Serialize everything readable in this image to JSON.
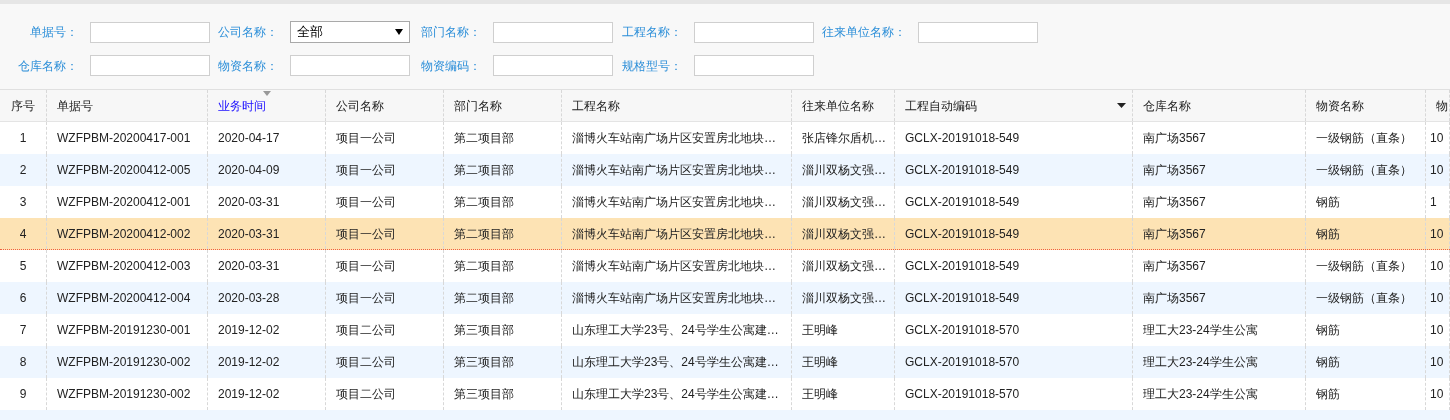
{
  "filters": [
    {
      "label": "单据号：",
      "kind": "text"
    },
    {
      "label": "公司名称：",
      "kind": "select",
      "value": "全部"
    },
    {
      "label": "部门名称：",
      "kind": "text"
    },
    {
      "label": "工程名称：",
      "kind": "text"
    },
    {
      "label": "往来单位名称：",
      "kind": "text"
    },
    {
      "label": "仓库名称：",
      "kind": "text"
    },
    {
      "label": "物资名称：",
      "kind": "text"
    },
    {
      "label": "物资编码：",
      "kind": "text"
    },
    {
      "label": "规格型号：",
      "kind": "text"
    }
  ],
  "table": {
    "columns": [
      {
        "label": "序号",
        "sorted": false,
        "menu": false
      },
      {
        "label": "单据号",
        "sorted": false,
        "menu": false
      },
      {
        "label": "业务时间",
        "sorted": true,
        "menu": false
      },
      {
        "label": "公司名称",
        "sorted": false,
        "menu": false
      },
      {
        "label": "部门名称",
        "sorted": false,
        "menu": false
      },
      {
        "label": "工程名称",
        "sorted": false,
        "menu": false
      },
      {
        "label": "往来单位名称",
        "sorted": false,
        "menu": false
      },
      {
        "label": "工程自动编码",
        "sorted": false,
        "menu": true
      },
      {
        "label": "仓库名称",
        "sorted": false,
        "menu": false
      },
      {
        "label": "物资名称",
        "sorted": false,
        "menu": false
      },
      {
        "label": "物",
        "sorted": false,
        "menu": false
      }
    ],
    "rows": [
      {
        "selected": false,
        "cells": [
          "1",
          "WZFPBM-20200417-001",
          "2020-04-17",
          "项目一公司",
          "第二项目部",
          "淄博火车站南广场片区安置房北地块…",
          "张店锋尔盾机…",
          "GCLX-20191018-549",
          "南广场3567",
          "一级钢筋（直条）",
          "10"
        ]
      },
      {
        "selected": false,
        "cells": [
          "2",
          "WZFPBM-20200412-005",
          "2020-04-09",
          "项目一公司",
          "第二项目部",
          "淄博火车站南广场片区安置房北地块…",
          "淄川双杨文强…",
          "GCLX-20191018-549",
          "南广场3567",
          "一级钢筋（直条）",
          "10"
        ]
      },
      {
        "selected": false,
        "cells": [
          "3",
          "WZFPBM-20200412-001",
          "2020-03-31",
          "项目一公司",
          "第二项目部",
          "淄博火车站南广场片区安置房北地块…",
          "淄川双杨文强…",
          "GCLX-20191018-549",
          "南广场3567",
          "钢筋",
          "1"
        ]
      },
      {
        "selected": true,
        "cells": [
          "4",
          "WZFPBM-20200412-002",
          "2020-03-31",
          "项目一公司",
          "第二项目部",
          "淄博火车站南广场片区安置房北地块…",
          "淄川双杨文强…",
          "GCLX-20191018-549",
          "南广场3567",
          "钢筋",
          "10"
        ]
      },
      {
        "selected": false,
        "cells": [
          "5",
          "WZFPBM-20200412-003",
          "2020-03-31",
          "项目一公司",
          "第二项目部",
          "淄博火车站南广场片区安置房北地块…",
          "淄川双杨文强…",
          "GCLX-20191018-549",
          "南广场3567",
          "一级钢筋（直条）",
          "10"
        ]
      },
      {
        "selected": false,
        "cells": [
          "6",
          "WZFPBM-20200412-004",
          "2020-03-28",
          "项目一公司",
          "第二项目部",
          "淄博火车站南广场片区安置房北地块…",
          "淄川双杨文强…",
          "GCLX-20191018-549",
          "南广场3567",
          "一级钢筋（直条）",
          "10"
        ]
      },
      {
        "selected": false,
        "cells": [
          "7",
          "WZFPBM-20191230-001",
          "2019-12-02",
          "项目二公司",
          "第三项目部",
          "山东理工大学23号、24号学生公寓建…",
          "王明峰",
          "GCLX-20191018-570",
          "理工大23-24学生公寓",
          "钢筋",
          "10"
        ]
      },
      {
        "selected": false,
        "cells": [
          "8",
          "WZFPBM-20191230-002",
          "2019-12-02",
          "项目二公司",
          "第三项目部",
          "山东理工大学23号、24号学生公寓建…",
          "王明峰",
          "GCLX-20191018-570",
          "理工大23-24学生公寓",
          "钢筋",
          "10"
        ]
      },
      {
        "selected": false,
        "cells": [
          "9",
          "WZFPBM-20191230-002",
          "2019-12-02",
          "项目二公司",
          "第三项目部",
          "山东理工大学23号、24号学生公寓建…",
          "王明峰",
          "GCLX-20191018-570",
          "理工大23-24学生公寓",
          "钢筋",
          "10"
        ]
      }
    ]
  }
}
